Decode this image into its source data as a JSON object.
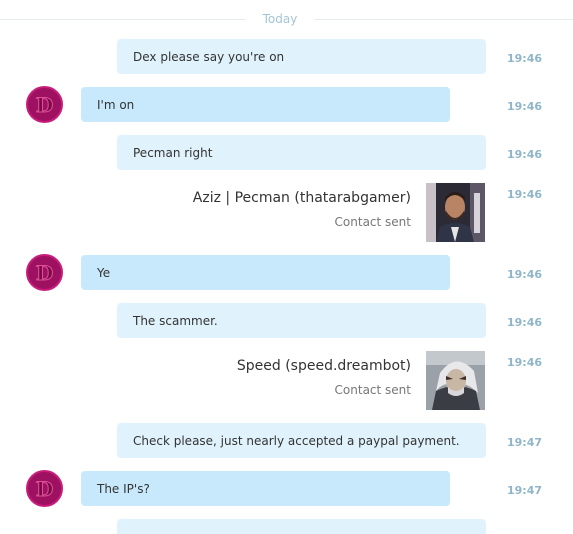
{
  "date_divider": "Today",
  "messages": [
    {
      "text": "Dex please say you're on",
      "time": "19:46"
    },
    {
      "text": "I'm on",
      "time": "19:46"
    },
    {
      "text": "Pecman right",
      "time": "19:46"
    },
    {
      "contact_name": "Aziz | Pecman (thatarabgamer)",
      "contact_sub": "Contact sent",
      "time": "19:46"
    },
    {
      "text": "Ye",
      "time": "19:46"
    },
    {
      "text": "The scammer.",
      "time": "19:46"
    },
    {
      "contact_name": "Speed (speed.dreambot)",
      "contact_sub": "Contact sent",
      "time": "19:46"
    },
    {
      "text": "Check please, just nearly accepted a paypal payment.",
      "time": "19:47"
    },
    {
      "text": "The IP's?",
      "time": "19:47"
    },
    {
      "text": "",
      "time": ""
    }
  ],
  "colors": {
    "outgoing_bubble": "#e0f3fc",
    "incoming_bubble": "#c7e9fb",
    "timestamp": "#8fb5c9",
    "avatar": "#9e1060"
  },
  "icons": {
    "avatar": "avatar-glyph-icon"
  }
}
